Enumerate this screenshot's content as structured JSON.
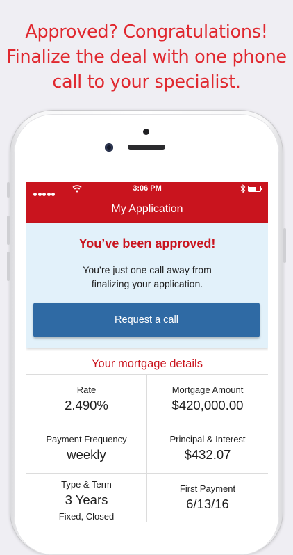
{
  "promo": {
    "line1": "Approved? Congratulations!",
    "line2": "Finalize the deal with one phone",
    "line3": "call to your specialist."
  },
  "status_bar": {
    "time": "3:06 PM"
  },
  "nav": {
    "title": "My Application"
  },
  "approval": {
    "title": "You’ve been approved!",
    "message_line1": "You’re just one call away from",
    "message_line2": "finalizing your application.",
    "button_label": "Request a call"
  },
  "details": {
    "title": "Your mortgage details",
    "rate": {
      "label": "Rate",
      "value": "2.490%"
    },
    "mortgage_amount": {
      "label": "Mortgage Amount",
      "value": "$420,000.00"
    },
    "payment_frequency": {
      "label": "Payment Frequency",
      "value": "weekly"
    },
    "principal_interest": {
      "label": "Principal & Interest",
      "value": "$432.07"
    },
    "type_term": {
      "label": "Type & Term",
      "value": "3 Years",
      "sub": "Fixed, Closed"
    },
    "first_payment": {
      "label": "First Payment",
      "value": "6/13/16"
    }
  },
  "colors": {
    "brand_red": "#c9141e",
    "promo_red": "#e0282f",
    "button_blue": "#2f6aa4",
    "approved_bg": "#e2f1fa"
  }
}
